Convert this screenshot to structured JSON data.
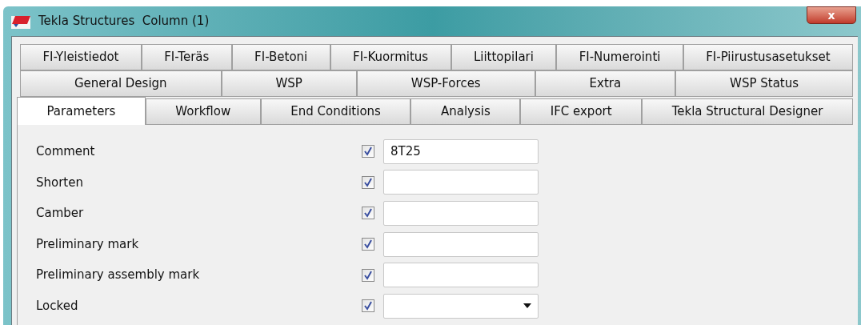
{
  "window": {
    "title": "Tekla Structures  Column (1)",
    "close_label": "x"
  },
  "tab_rows": [
    [
      {
        "label": "FI-Yleistiedot",
        "selected": false
      },
      {
        "label": "FI-Teräs",
        "selected": false
      },
      {
        "label": "FI-Betoni",
        "selected": false
      },
      {
        "label": "FI-Kuormitus",
        "selected": false
      },
      {
        "label": "Liittopilari",
        "selected": false
      },
      {
        "label": "FI-Numerointi",
        "selected": false
      },
      {
        "label": "FI-Piirustusasetukset",
        "selected": false
      }
    ],
    [
      {
        "label": "General Design",
        "selected": false
      },
      {
        "label": "WSP",
        "selected": false
      },
      {
        "label": "WSP-Forces",
        "selected": false
      },
      {
        "label": "Extra",
        "selected": false
      },
      {
        "label": "WSP Status",
        "selected": false
      }
    ],
    [
      {
        "label": "Parameters",
        "selected": true
      },
      {
        "label": "Workflow",
        "selected": false
      },
      {
        "label": "End Conditions",
        "selected": false
      },
      {
        "label": "Analysis",
        "selected": false
      },
      {
        "label": "IFC export",
        "selected": false
      },
      {
        "label": "Tekla Structural Designer",
        "selected": false
      }
    ]
  ],
  "fields": [
    {
      "label": "Comment",
      "checked": true,
      "kind": "text",
      "value": "8T25"
    },
    {
      "label": "Shorten",
      "checked": true,
      "kind": "text"
    },
    {
      "label": "Camber",
      "checked": true,
      "kind": "text"
    },
    {
      "label": "Preliminary mark",
      "checked": true,
      "kind": "text"
    },
    {
      "label": "Preliminary assembly mark",
      "checked": true,
      "kind": "text"
    },
    {
      "label": "Locked",
      "checked": true,
      "kind": "dropdown"
    }
  ]
}
